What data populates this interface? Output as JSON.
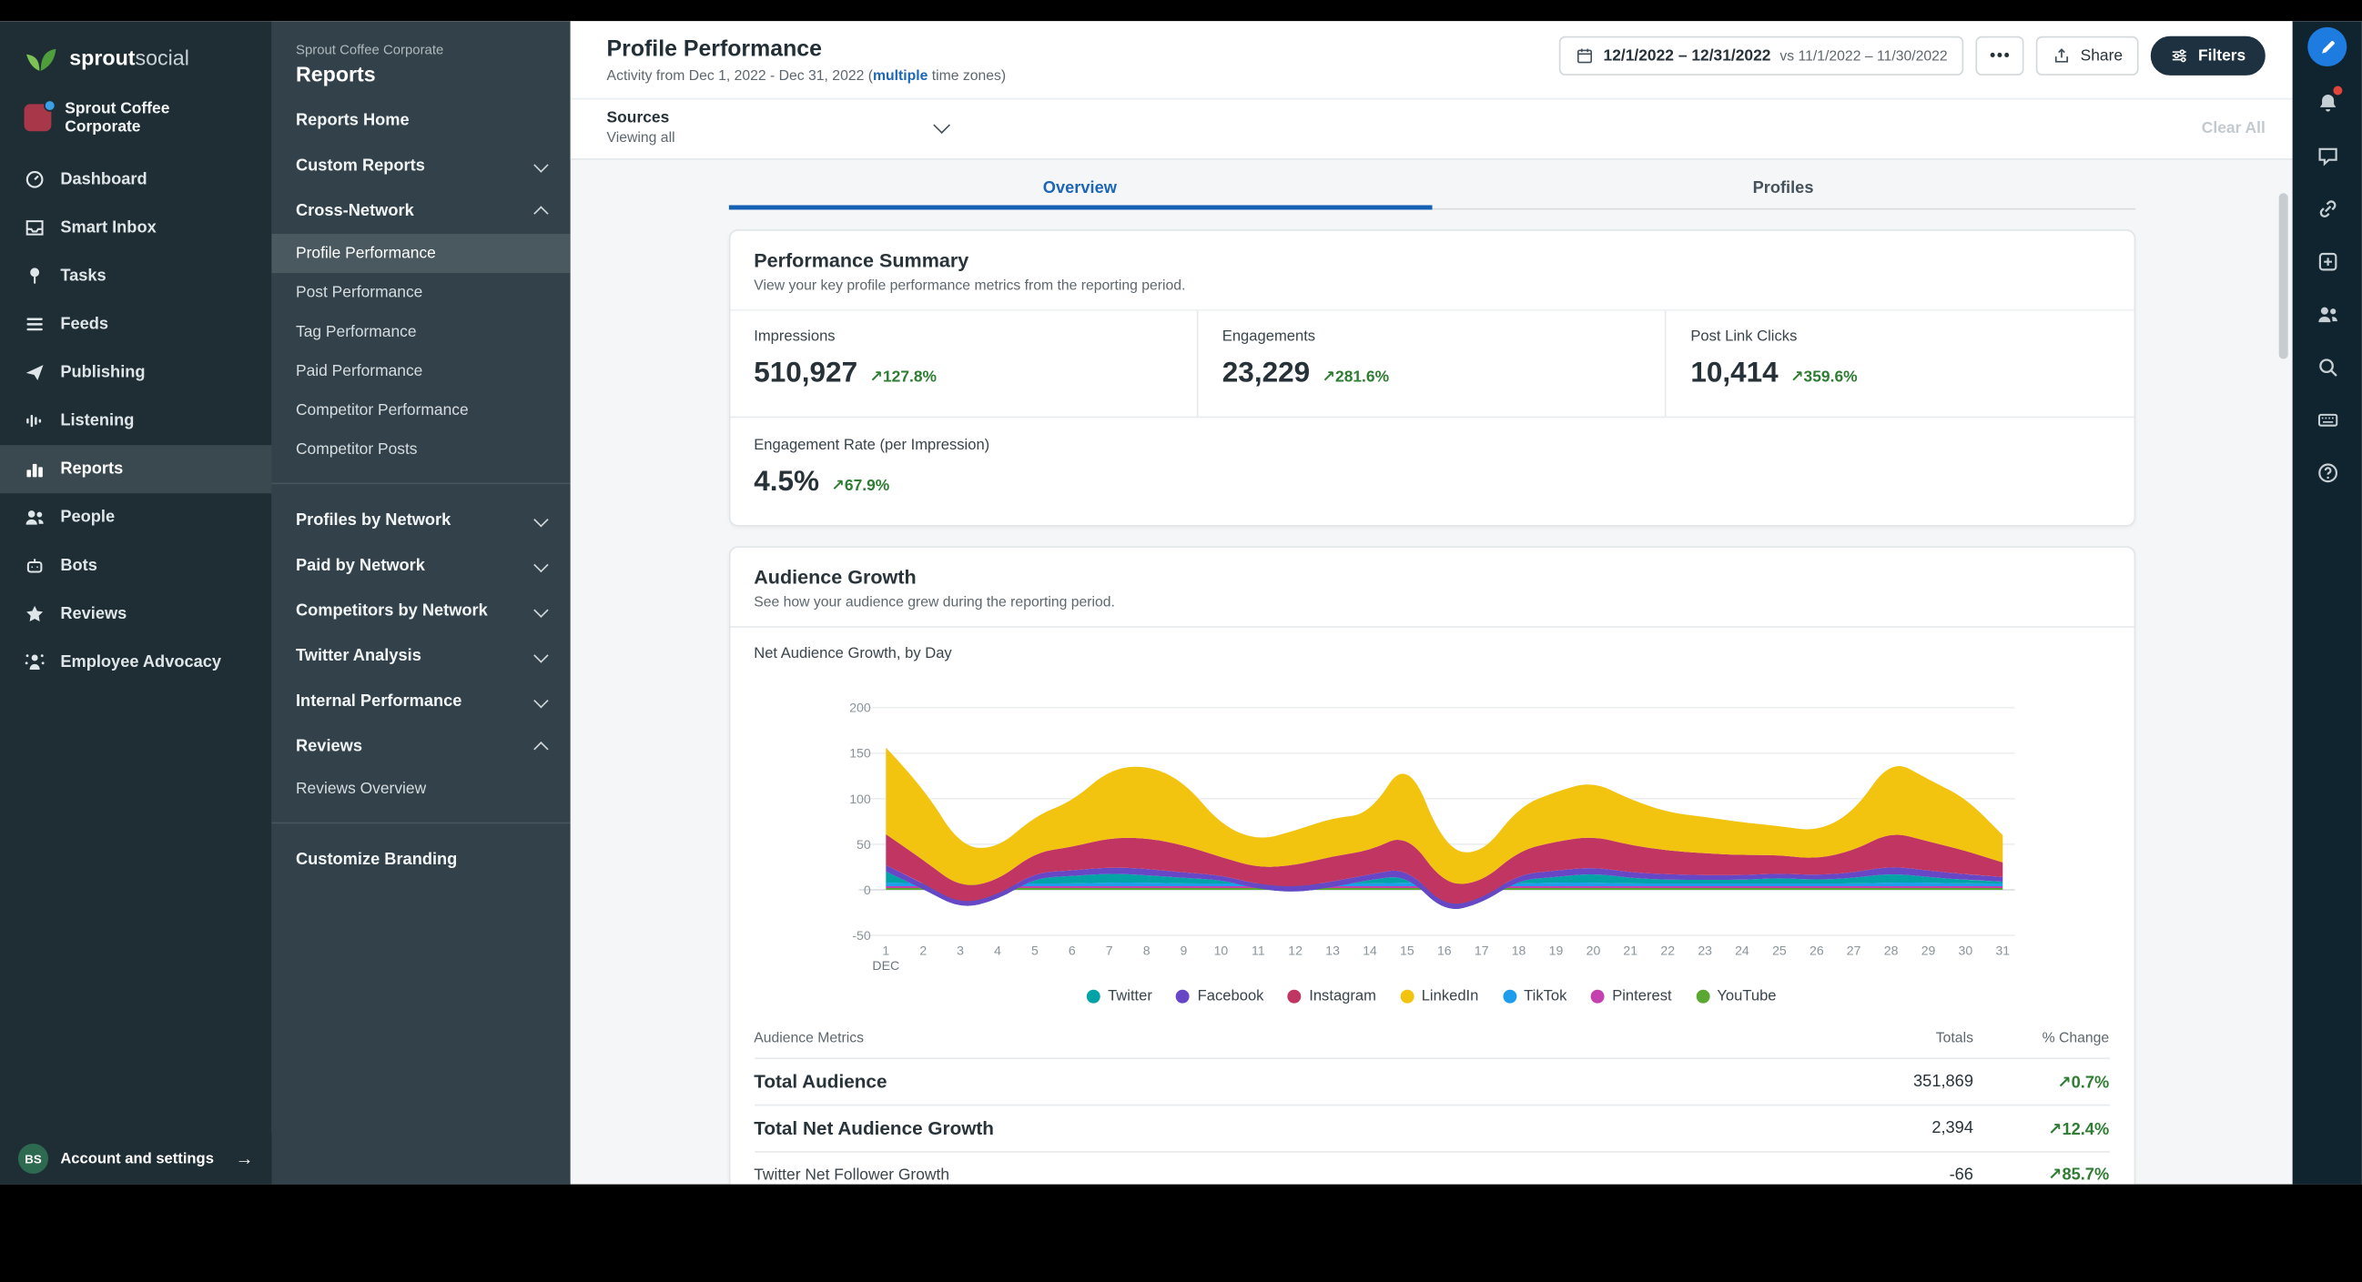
{
  "brand": {
    "bold": "sprout",
    "light": "social"
  },
  "account": {
    "name": "Sprout Coffee Corporate"
  },
  "left_nav": {
    "items": [
      {
        "label": "Dashboard",
        "icon": "dashboard-icon",
        "active": false
      },
      {
        "label": "Smart Inbox",
        "icon": "inbox-icon",
        "active": false
      },
      {
        "label": "Tasks",
        "icon": "pin-icon",
        "active": false
      },
      {
        "label": "Feeds",
        "icon": "feeds-icon",
        "active": false
      },
      {
        "label": "Publishing",
        "icon": "publish-icon",
        "active": false
      },
      {
        "label": "Listening",
        "icon": "listening-icon",
        "active": false
      },
      {
        "label": "Reports",
        "icon": "reports-icon",
        "active": true
      },
      {
        "label": "People",
        "icon": "people-icon",
        "active": false
      },
      {
        "label": "Bots",
        "icon": "bot-icon",
        "active": false
      },
      {
        "label": "Reviews",
        "icon": "star-icon",
        "active": false
      },
      {
        "label": "Employee Advocacy",
        "icon": "advocacy-icon",
        "active": false
      }
    ],
    "footer": {
      "initials": "BS",
      "label": "Account and settings"
    }
  },
  "reports_nav": {
    "eyebrow": "Sprout Coffee Corporate",
    "title": "Reports",
    "items": [
      {
        "kind": "link",
        "label": "Reports Home"
      },
      {
        "kind": "group",
        "label": "Custom Reports",
        "state": "collapsed"
      },
      {
        "kind": "group",
        "label": "Cross-Network",
        "state": "expanded"
      },
      {
        "kind": "subitem",
        "label": "Profile Performance",
        "active": true
      },
      {
        "kind": "subitem",
        "label": "Post Performance",
        "active": false
      },
      {
        "kind": "subitem",
        "label": "Tag Performance",
        "active": false
      },
      {
        "kind": "subitem",
        "label": "Paid Performance",
        "active": false
      },
      {
        "kind": "subitem",
        "label": "Competitor Performance",
        "active": false
      },
      {
        "kind": "subitem",
        "label": "Competitor Posts",
        "active": false
      },
      {
        "kind": "divider"
      },
      {
        "kind": "group",
        "label": "Profiles by Network",
        "state": "collapsed"
      },
      {
        "kind": "group",
        "label": "Paid by Network",
        "state": "collapsed"
      },
      {
        "kind": "group",
        "label": "Competitors by Network",
        "state": "collapsed"
      },
      {
        "kind": "group",
        "label": "Twitter Analysis",
        "state": "collapsed"
      },
      {
        "kind": "group",
        "label": "Internal Performance",
        "state": "collapsed"
      },
      {
        "kind": "group",
        "label": "Reviews",
        "state": "expanded"
      },
      {
        "kind": "subitem",
        "label": "Reviews Overview",
        "active": false
      },
      {
        "kind": "divider"
      },
      {
        "kind": "link",
        "label": "Customize Branding"
      }
    ]
  },
  "header": {
    "title": "Profile Performance",
    "subtitle_prefix": "Activity from Dec 1, 2022 - Dec 31, 2022 (",
    "subtitle_link": "multiple",
    "subtitle_suffix": " time zones)",
    "date_range": "12/1/2022 – 12/31/2022",
    "date_compare": "vs 11/1/2022 – 11/30/2022",
    "more_label": "•••",
    "share_label": "Share",
    "filters_label": "Filters"
  },
  "sources": {
    "label": "Sources",
    "value": "Viewing all",
    "clear": "Clear All"
  },
  "tabs": [
    {
      "label": "Overview",
      "active": true
    },
    {
      "label": "Profiles",
      "active": false
    }
  ],
  "performance_summary": {
    "title": "Performance Summary",
    "subtitle": "View your key profile performance metrics from the reporting period.",
    "metrics": [
      {
        "label": "Impressions",
        "value": "510,927",
        "change": "↗127.8%"
      },
      {
        "label": "Engagements",
        "value": "23,229",
        "change": "↗281.6%"
      },
      {
        "label": "Post Link Clicks",
        "value": "10,414",
        "change": "↗359.6%"
      }
    ],
    "secondary_metric": {
      "label": "Engagement Rate (per Impression)",
      "value": "4.5%",
      "change": "↗67.9%"
    }
  },
  "audience_growth": {
    "title": "Audience Growth",
    "subtitle": "See how your audience grew during the reporting period.",
    "chart_label": "Net Audience Growth, by Day"
  },
  "chart_data": {
    "type": "area",
    "stacked": true,
    "title": "Net Audience Growth, by Day",
    "x": [
      1,
      2,
      3,
      4,
      5,
      6,
      7,
      8,
      9,
      10,
      11,
      12,
      13,
      14,
      15,
      16,
      17,
      18,
      19,
      20,
      21,
      22,
      23,
      24,
      25,
      26,
      27,
      28,
      29,
      30,
      31
    ],
    "x_axis_label": "DEC",
    "ylim": [
      -50,
      200
    ],
    "y_ticks": [
      200,
      150,
      100,
      50,
      0,
      -50
    ],
    "grid": true,
    "legend_position": "bottom",
    "stack_order_bottom_to_top": [
      "YouTube",
      "Pinterest",
      "TikTok",
      "Twitter",
      "Facebook",
      "Instagram",
      "LinkedIn"
    ],
    "series": [
      {
        "name": "Twitter",
        "color": "#00a4a6",
        "values": [
          12,
          -6,
          -28,
          -18,
          6,
          8,
          10,
          8,
          6,
          4,
          -6,
          -10,
          -4,
          4,
          8,
          -32,
          -22,
          4,
          6,
          10,
          6,
          4,
          4,
          4,
          6,
          4,
          6,
          10,
          6,
          4,
          2
        ]
      },
      {
        "name": "Facebook",
        "color": "#6747c6",
        "values": [
          7,
          6,
          5,
          5,
          6,
          6,
          7,
          7,
          6,
          5,
          5,
          6,
          6,
          6,
          8,
          6,
          5,
          6,
          7,
          7,
          6,
          6,
          5,
          5,
          5,
          5,
          6,
          8,
          7,
          6,
          5
        ]
      },
      {
        "name": "Instagram",
        "color": "#c13562",
        "values": [
          34,
          26,
          18,
          16,
          22,
          26,
          32,
          34,
          30,
          20,
          18,
          24,
          28,
          26,
          38,
          24,
          18,
          26,
          32,
          34,
          30,
          26,
          24,
          22,
          20,
          18,
          24,
          38,
          32,
          26,
          16
        ]
      },
      {
        "name": "LinkedIn",
        "color": "#f2c30f",
        "values": [
          95,
          80,
          45,
          35,
          40,
          50,
          75,
          80,
          70,
          35,
          30,
          38,
          42,
          40,
          85,
          40,
          30,
          48,
          55,
          60,
          50,
          42,
          40,
          36,
          32,
          30,
          42,
          80,
          68,
          58,
          30
        ]
      },
      {
        "name": "TikTok",
        "color": "#1e9ded",
        "values": [
          4,
          3,
          3,
          3,
          3,
          3,
          4,
          4,
          3,
          3,
          3,
          3,
          3,
          3,
          4,
          3,
          3,
          3,
          4,
          4,
          3,
          3,
          3,
          3,
          3,
          3,
          3,
          4,
          4,
          3,
          3
        ]
      },
      {
        "name": "Pinterest",
        "color": "#c340ae",
        "values": [
          2,
          2,
          2,
          2,
          2,
          2,
          2,
          2,
          2,
          2,
          2,
          2,
          2,
          2,
          2,
          2,
          2,
          2,
          2,
          2,
          2,
          2,
          2,
          2,
          2,
          2,
          2,
          2,
          2,
          2,
          2
        ]
      },
      {
        "name": "YouTube",
        "color": "#5aa832",
        "values": [
          2,
          2,
          2,
          2,
          2,
          2,
          2,
          2,
          2,
          2,
          2,
          2,
          2,
          2,
          2,
          2,
          2,
          2,
          2,
          2,
          2,
          2,
          2,
          2,
          2,
          2,
          2,
          2,
          2,
          2,
          2
        ]
      }
    ]
  },
  "audience_table": {
    "columns": [
      "Audience Metrics",
      "Totals",
      "% Change"
    ],
    "rows": [
      {
        "name": "Total Audience",
        "total": "351,869",
        "change": "↗0.7%",
        "emphasis": true
      },
      {
        "name": "Total Net Audience Growth",
        "total": "2,394",
        "change": "↗12.4%",
        "emphasis": true
      },
      {
        "name": "Twitter Net Follower Growth",
        "total": "-66",
        "change": "↗85.7%",
        "emphasis": false
      }
    ]
  },
  "right_rail": [
    {
      "name": "compose-icon",
      "primary": true,
      "badge": false
    },
    {
      "name": "alerts-icon",
      "primary": false,
      "badge": true
    },
    {
      "name": "feedback-icon",
      "primary": false,
      "badge": false
    },
    {
      "name": "link-icon",
      "primary": false,
      "badge": false
    },
    {
      "name": "add-icon",
      "primary": false,
      "badge": false
    },
    {
      "name": "team-icon",
      "primary": false,
      "badge": false
    },
    {
      "name": "search-icon",
      "primary": false,
      "badge": false
    },
    {
      "name": "keyboard-icon",
      "primary": false,
      "badge": false
    },
    {
      "name": "help-icon",
      "primary": false,
      "badge": false
    }
  ],
  "colors": {
    "accent_blue": "#1c66b8",
    "positive_green": "#2e7d32",
    "filters_dark": "#1d3140",
    "compose_blue": "#1e7ce0",
    "alert_red": "#e0443a"
  }
}
